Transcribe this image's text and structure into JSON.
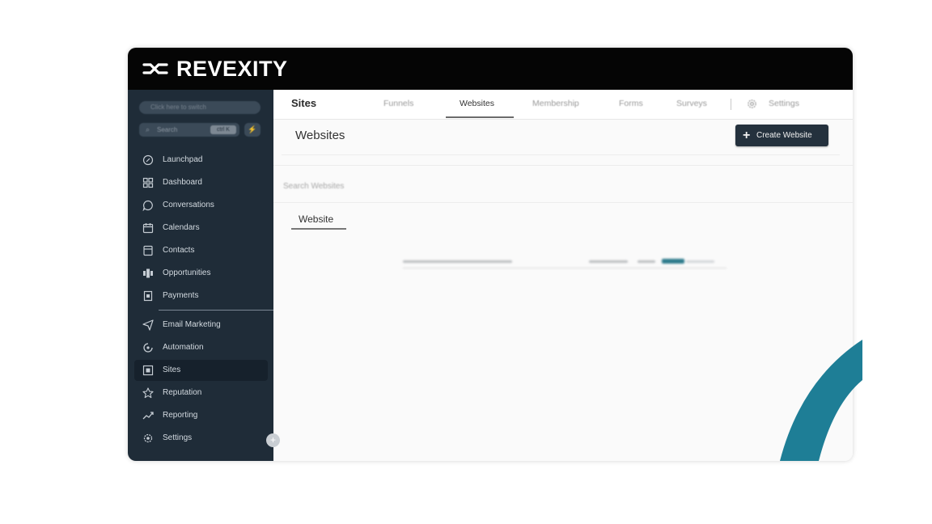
{
  "brand": {
    "name": "REVEXITY"
  },
  "sidebar": {
    "account_switcher": "Click here to switch",
    "search": {
      "label": "Search",
      "shortcut": "ctrl K"
    },
    "quick_action": "⚡",
    "items": [
      {
        "label": "Launchpad",
        "icon": "rocket-icon"
      },
      {
        "label": "Dashboard",
        "icon": "dashboard-icon"
      },
      {
        "label": "Conversations",
        "icon": "chat-bubble-icon"
      },
      {
        "label": "Calendars",
        "icon": "calendar-icon"
      },
      {
        "label": "Contacts",
        "icon": "contacts-icon"
      },
      {
        "label": "Opportunities",
        "icon": "opportunities-icon"
      },
      {
        "label": "Payments",
        "icon": "payments-icon"
      },
      {
        "label": "Email Marketing",
        "icon": "send-icon"
      },
      {
        "label": "Automation",
        "icon": "automation-icon"
      },
      {
        "label": "Sites",
        "icon": "sites-icon",
        "active": true
      },
      {
        "label": "Reputation",
        "icon": "star-icon"
      },
      {
        "label": "Reporting",
        "icon": "trend-icon"
      },
      {
        "label": "Settings",
        "icon": "gear-icon"
      }
    ],
    "collapse_label": "+"
  },
  "main": {
    "section_title": "Sites",
    "tabs": [
      {
        "label": "Funnels",
        "active": false
      },
      {
        "label": "Websites",
        "active": true
      },
      {
        "label": "Membership",
        "active": false
      },
      {
        "label": "Forms",
        "active": false
      },
      {
        "label": "Surveys",
        "active": false
      }
    ],
    "settings_label": "Settings",
    "page_title": "Websites",
    "create_button": {
      "icon": "+",
      "label": "Create Website"
    },
    "search_placeholder": "Search Websites",
    "sub_tab": "Website"
  },
  "colors": {
    "brand_bar": "#050505",
    "sidebar_bg": "#1f2c38",
    "accent_teal": "#1e7e96",
    "button_dark": "#24313d"
  }
}
